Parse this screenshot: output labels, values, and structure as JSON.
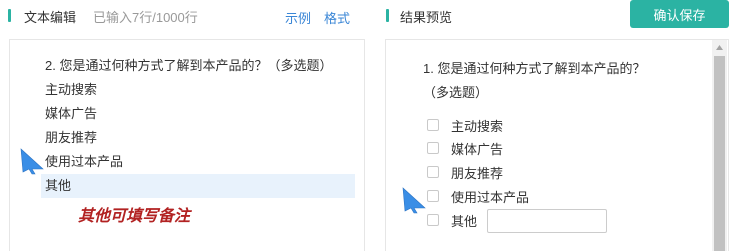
{
  "editor_header": {
    "title": "文本编辑",
    "line_count": "已输入7行/1000行",
    "example_link": "示例",
    "format_link": "格式"
  },
  "preview_header": {
    "title": "结果预览",
    "save_button": "确认保存"
  },
  "editor": {
    "lines": [
      "2. 您是通过何种方式了解到本产品的？（多选题）",
      "主动搜索",
      "媒体广告",
      "朋友推荐",
      "使用过本产品",
      "其他"
    ],
    "annotation": "其他可填写备注"
  },
  "preview": {
    "question_line1": "1. 您是通过何种方式了解到本产品的？",
    "question_line2": "（多选题）",
    "options": [
      "主动搜索",
      "媒体广告",
      "朋友推荐",
      "使用过本产品",
      "其他"
    ]
  },
  "colors": {
    "accent": "#2bb3a3",
    "link": "#3a86d6",
    "highlight_row": "#e8f2fc",
    "annotation": "#b22222",
    "pointer_arrow": "#3a8ee6"
  },
  "icons": {
    "pointer": "blue-arrow-icon",
    "scroll_up": "chevron-up-icon"
  }
}
